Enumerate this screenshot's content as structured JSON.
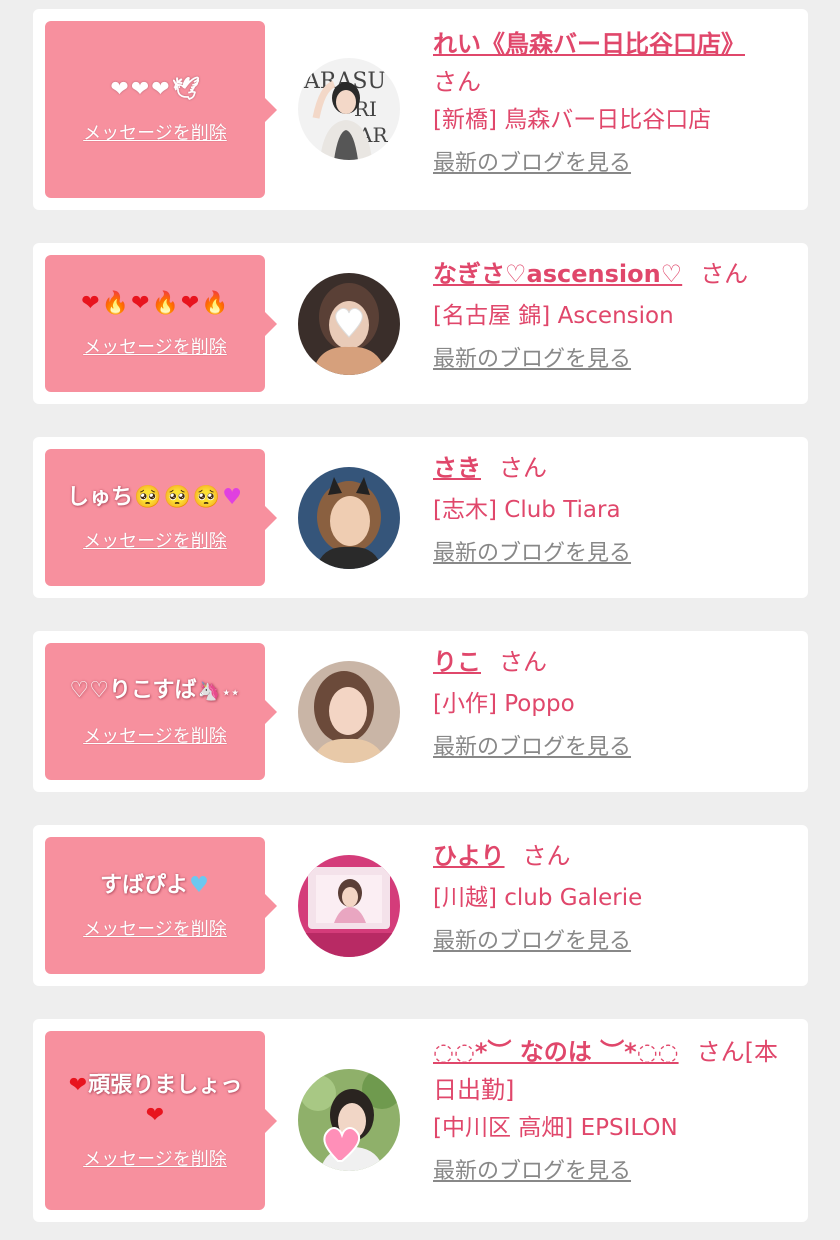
{
  "delete_label": "メッセージを削除",
  "blog_label": "最新のブログを見る",
  "san_label": "さん",
  "cards": [
    {
      "message_text": "",
      "message_emoji": [
        "white-heart",
        "white-heart",
        "white-heart",
        "dove"
      ],
      "name": "れい《鳥森バー日比谷口店》",
      "suffix": "さん",
      "shop": "[新橋] 鳥森バー日比谷口店"
    },
    {
      "message_text": "",
      "message_emoji": [
        "red-heart",
        "fire",
        "red-heart",
        "fire",
        "red-heart",
        "fire"
      ],
      "name": "なぎさ♡ascension♡",
      "suffix": "さん",
      "shop": "[名古屋 錦] Ascension"
    },
    {
      "message_text": "しゅち",
      "message_emoji": [
        "pleading-face",
        "pleading-face",
        "pleading-face",
        "purple-heart"
      ],
      "name": "さき",
      "suffix": "さん",
      "shop": "[志木] Club Tiara"
    },
    {
      "message_text": "♡♡りこすば",
      "message_emoji": [
        "unicorn",
        "sparkles"
      ],
      "name": "りこ",
      "suffix": "さん",
      "shop": "[小作] Poppo"
    },
    {
      "message_text": "すばぴよ",
      "message_emoji": [
        "blue-heart"
      ],
      "name": "ひより",
      "suffix": "さん",
      "shop": "[川越] club Galerie"
    },
    {
      "message_text": "頑張りましょっ",
      "message_emoji": [
        "red-heart",
        "red-heart"
      ],
      "name": "◌◌*︶ なのは ︶*◌◌",
      "suffix": "さん[本日出勤]",
      "shop": "[中川区 高畑] EPSILON"
    }
  ],
  "colors": {
    "background": "#eeeeee",
    "card": "#ffffff",
    "bubble": "#f7909e",
    "name": "#e0476b",
    "blog_link": "#888888"
  }
}
